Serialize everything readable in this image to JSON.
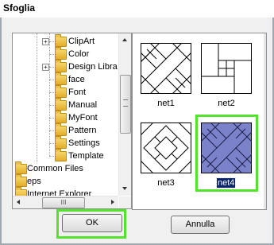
{
  "window": {
    "title": "Sfoglia"
  },
  "tree": {
    "items": [
      {
        "label": "ClipArt",
        "expandable": true
      },
      {
        "label": "Color",
        "expandable": false
      },
      {
        "label": "Design Libra",
        "expandable": true
      },
      {
        "label": "face",
        "expandable": false
      },
      {
        "label": "Font",
        "expandable": false
      },
      {
        "label": "Manual",
        "expandable": false
      },
      {
        "label": "MyFont",
        "expandable": false
      },
      {
        "label": "Pattern",
        "expandable": false
      },
      {
        "label": "Settings",
        "expandable": false
      },
      {
        "label": "Template",
        "expandable": false
      },
      {
        "label": "Common Files",
        "expandable": false
      },
      {
        "label": "eps",
        "expandable": false
      },
      {
        "label": "Internet Explorer",
        "expandable": false
      }
    ],
    "expand_symbol": "+",
    "hscroll_grip": "III"
  },
  "thumbnails": [
    {
      "label": "net1",
      "selected": false,
      "pattern": "diagonal-weave"
    },
    {
      "label": "net2",
      "selected": false,
      "pattern": "pinwheel-rect"
    },
    {
      "label": "net3",
      "selected": false,
      "pattern": "diagonal-diamond"
    },
    {
      "label": "net4",
      "selected": true,
      "pattern": "diagonal-weave-filled"
    }
  ],
  "buttons": {
    "ok": "OK",
    "cancel": "Annulla"
  },
  "colors": {
    "highlight": "#55e22d",
    "selection": "#0a246a",
    "net4_fill": "#7b82c9"
  }
}
